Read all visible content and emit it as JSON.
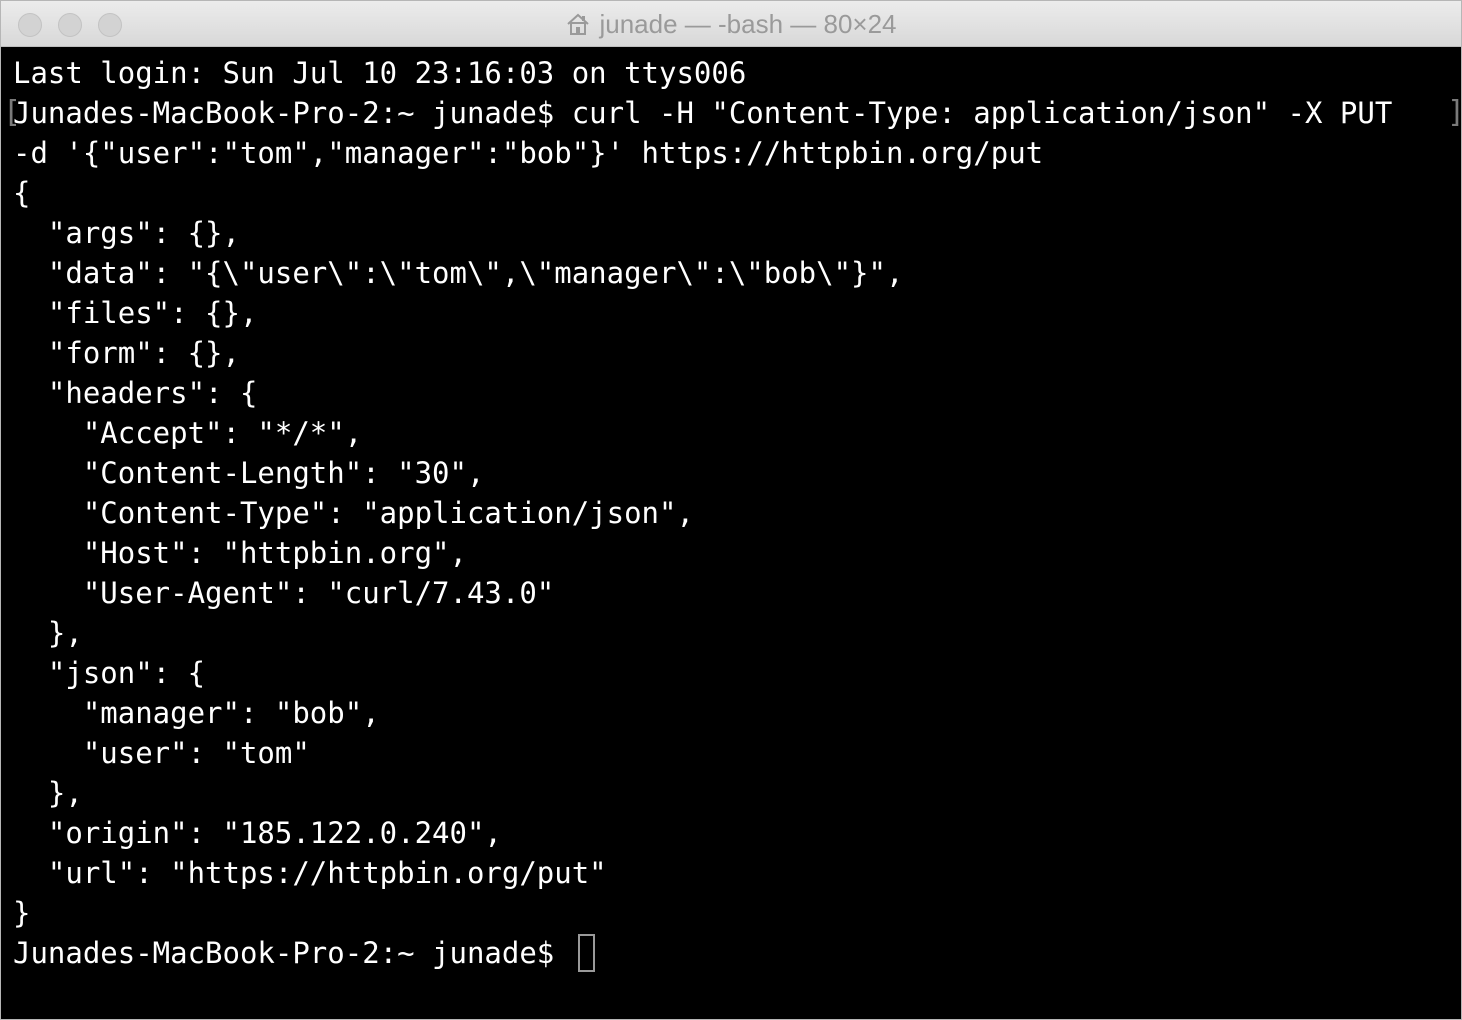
{
  "window": {
    "title": "junade — -bash — 80×24",
    "title_icon": "home-icon"
  },
  "terminal": {
    "lines": [
      "Last login: Sun Jul 10 23:16:03 on ttys006",
      "Junades-MacBook-Pro-2:~ junade$ curl -H \"Content-Type: application/json\" -X PUT",
      "-d '{\"user\":\"tom\",\"manager\":\"bob\"}' https://httpbin.org/put",
      "{",
      "  \"args\": {},",
      "  \"data\": \"{\\\"user\\\":\\\"tom\\\",\\\"manager\\\":\\\"bob\\\"}\",",
      "  \"files\": {},",
      "  \"form\": {},",
      "  \"headers\": {",
      "    \"Accept\": \"*/*\",",
      "    \"Content-Length\": \"30\",",
      "    \"Content-Type\": \"application/json\",",
      "    \"Host\": \"httpbin.org\",",
      "    \"User-Agent\": \"curl/7.43.0\"",
      "  },",
      "  \"json\": {",
      "    \"manager\": \"bob\",",
      "    \"user\": \"tom\"",
      "  },",
      "  \"origin\": \"185.122.0.240\",",
      "  \"url\": \"https://httpbin.org/put\"",
      "}"
    ],
    "prompt": "Junades-MacBook-Pro-2:~ junade$"
  },
  "colors": {
    "background": "#000000",
    "foreground": "#ffffff",
    "titlebar": "#e6e6e6",
    "title_text": "#9a9a9a"
  }
}
